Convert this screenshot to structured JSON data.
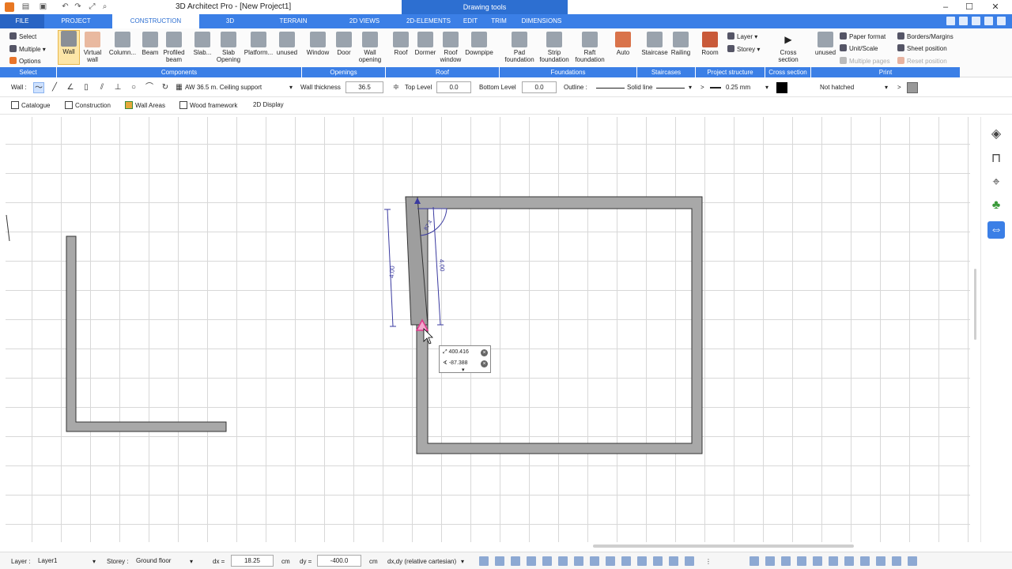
{
  "window": {
    "title": "3D Architect Pro - [New Project1]",
    "context_tab": "Drawing tools"
  },
  "menu": {
    "tabs": [
      "FILE",
      "PROJECT",
      "CONSTRUCTION",
      "3D",
      "TERRAIN",
      "2D VIEWS",
      "2D-ELEMENTS",
      "EDIT",
      "TRIM",
      "DIMENSIONS"
    ]
  },
  "ribbon": {
    "select": {
      "select": "Select",
      "multiple": "Multiple",
      "options": "Options"
    },
    "components": [
      "Wall",
      "Virtual wall",
      "Column...",
      "Beam",
      "Profiled beam",
      "Slab...",
      "Slab Opening",
      "Platform...",
      "unused"
    ],
    "openings": [
      "Window",
      "Door",
      "Wall opening"
    ],
    "roof": [
      "Roof",
      "Dormer",
      "Roof window",
      "Downpipe"
    ],
    "foundations": [
      "Pad foundation",
      "Strip foundation",
      "Raft foundation"
    ],
    "misc": [
      "Auto"
    ],
    "staircases": [
      "Staircase",
      "Railing"
    ],
    "project_structure": {
      "room": "Room",
      "layer": "Layer",
      "storey": "Storey"
    },
    "cross_section": "Cross section",
    "print": {
      "unused": "unused",
      "paper_format": "Paper format",
      "unit_scale": "Unit/Scale",
      "multiple_pages": "Multiple pages",
      "borders_margins": "Borders/Margins",
      "sheet_position": "Sheet position",
      "reset_position": "Reset position"
    },
    "groups": [
      "Select",
      "Components",
      "Openings",
      "Roof",
      "Foundations",
      "Staircases",
      "Project structure",
      "Cross section",
      "Print"
    ]
  },
  "options_bar": {
    "wall_label": "Wall :",
    "wall_type": "AW 36.5 m. Ceiling support",
    "wall_thickness_label": "Wall thickness",
    "wall_thickness": "36.5",
    "top_level_label": "Top Level",
    "top_level": "0.0",
    "bottom_level_label": "Bottom Level",
    "bottom_level": "0.0",
    "outline_label": "Outline :",
    "outline_style": "Solid line",
    "line_width": "0.25 mm",
    "hatch": "Not hatched"
  },
  "sub_toolbar": [
    "Catalogue",
    "Construction",
    "Wall Areas",
    "Wood framework",
    "2D Display"
  ],
  "drawing": {
    "dim_left": "4.00",
    "dim_right": "4.00",
    "angle": "87.4",
    "readout_length": "400.416",
    "readout_angle": "-87.388"
  },
  "status_bar": {
    "layer_label": "Layer :",
    "layer": "Layer1",
    "storey_label": "Storey :",
    "storey": "Ground floor",
    "dx_label": "dx =",
    "dx": "18.25",
    "dy_label": "dy =",
    "dy": "-400.0",
    "unit": "cm",
    "coord_mode": "dx,dy (relative cartesian)"
  },
  "colors": {
    "accent": "#3b7fe6",
    "wall_fill": "#a8a8a8",
    "dimension": "#3a3aa0",
    "marker": "#e0388a"
  }
}
